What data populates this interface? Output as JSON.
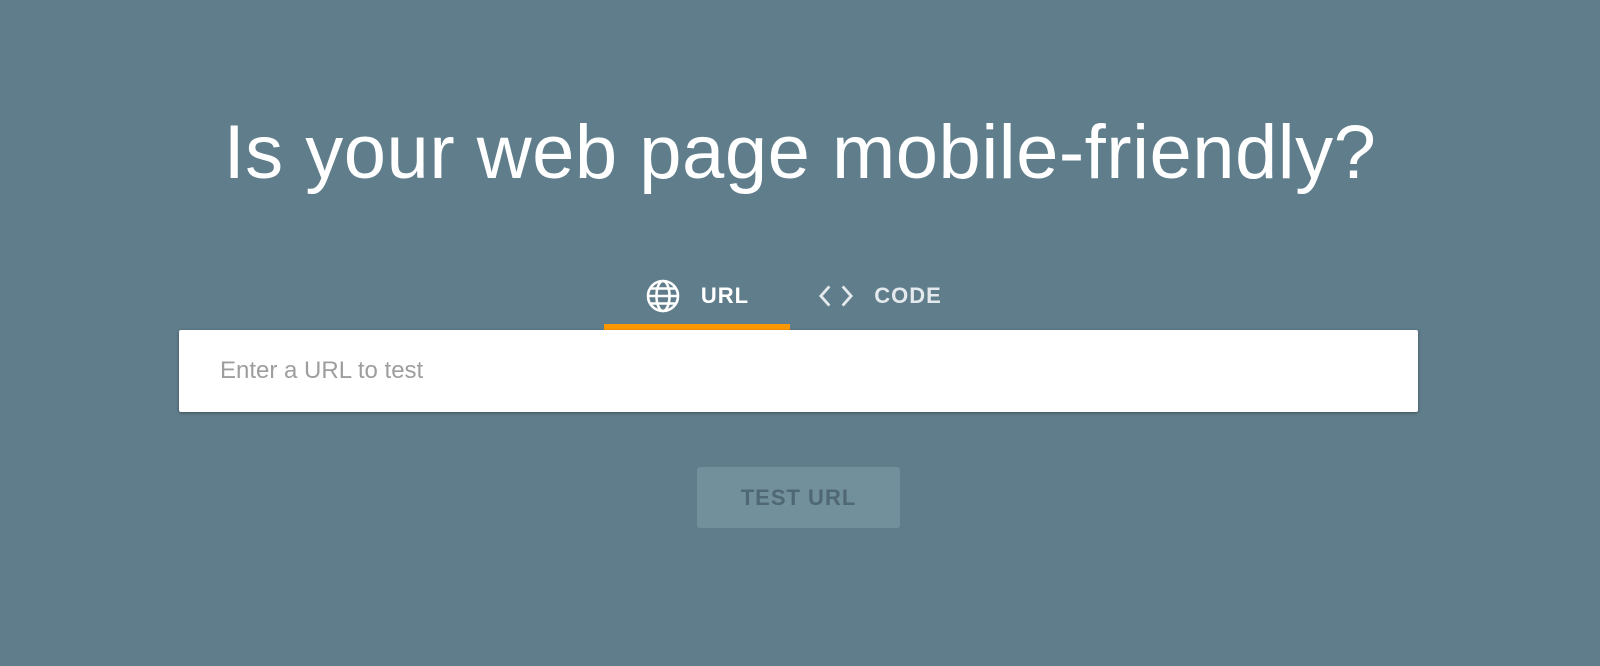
{
  "heading": "Is your web page mobile-friendly?",
  "tabs": [
    {
      "label": "URL",
      "icon": "globe-icon",
      "active": true
    },
    {
      "label": "CODE",
      "icon": "code-brackets-icon",
      "active": false
    }
  ],
  "url_input": {
    "placeholder": "Enter a URL to test",
    "value": ""
  },
  "submit": {
    "label": "TEST URL"
  },
  "colors": {
    "background": "#607d8b",
    "active_tab_indicator": "#ff9800",
    "button_background": "#72909c",
    "button_text": "#4f6873"
  }
}
